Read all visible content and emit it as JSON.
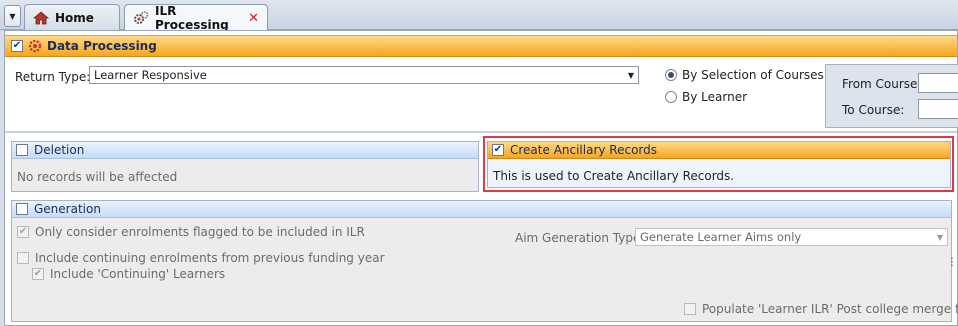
{
  "tabs": {
    "home_label": "Home",
    "active_label": "ILR Processing",
    "close_glyph": "✕"
  },
  "data_processing": {
    "title": "Data Processing",
    "checked": true
  },
  "return_type": {
    "label": "Return Type:",
    "value": "Learner Responsive"
  },
  "selection": {
    "by_courses": "By Selection of Courses",
    "by_learner": "By Learner",
    "selected": "by_courses"
  },
  "course_range": {
    "from_label": "From Course:",
    "to_label": "To Course:",
    "from_value": "",
    "to_value": ""
  },
  "deletion": {
    "title": "Deletion",
    "message": "No records will be affected"
  },
  "ancillary": {
    "title": "Create Ancillary Records",
    "message": "This is used to Create Ancillary Records.",
    "highlight_color": "#e0384a"
  },
  "generation": {
    "title": "Generation",
    "option_ilr": "Only consider enrolments flagged to be included in ILR",
    "option_continuing": "Include continuing enrolments from previous funding year",
    "option_continuing_learners": "Include 'Continuing' Learners",
    "aim_type_label": "Aim Generation Type:",
    "aim_type_value": "Generate Learner Aims only",
    "populate_label": "Populate 'Learner ILR' Post college merge fields"
  },
  "colors": {
    "orange_header": "#f6a51e",
    "blue_header": "#c7dcf4",
    "title_text": "#1b2d5a"
  }
}
